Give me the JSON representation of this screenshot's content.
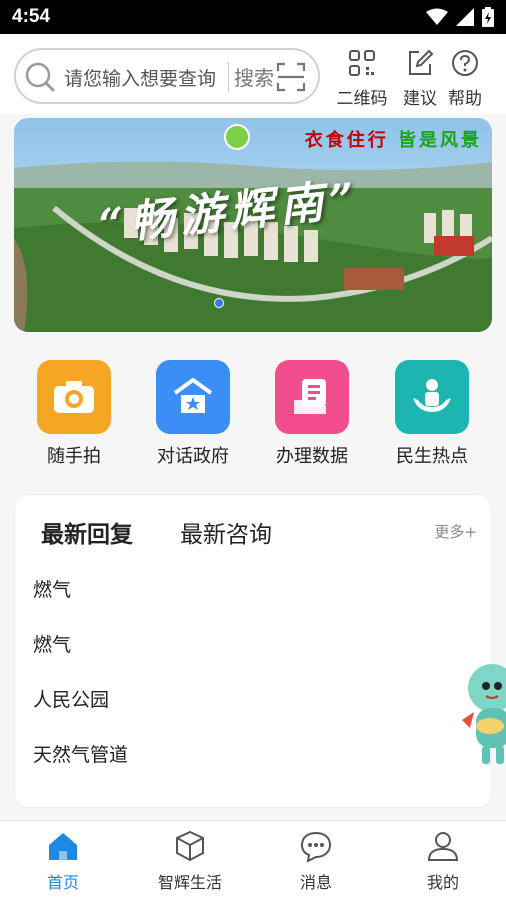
{
  "status_bar": {
    "time": "4:54"
  },
  "search": {
    "placeholder": "请您输入想要查询",
    "button_label": "搜索"
  },
  "tools": [
    {
      "label": "二维码",
      "icon": "qr-code-icon"
    },
    {
      "label": "建议",
      "icon": "edit-icon"
    },
    {
      "label": "帮助",
      "icon": "help-icon"
    }
  ],
  "banner": {
    "slogan_red": "衣食住行",
    "slogan_green": "皆是风景",
    "title": "“畅游辉南”"
  },
  "quick_actions": [
    {
      "label": "随手拍",
      "icon": "camera-icon",
      "color": "#f5a623"
    },
    {
      "label": "对话政府",
      "icon": "government-icon",
      "color": "#3a8ef6"
    },
    {
      "label": "办理数据",
      "icon": "data-icon",
      "color": "#f04e8c"
    },
    {
      "label": "民生热点",
      "icon": "people-icon",
      "color": "#1cb5b0"
    }
  ],
  "news": {
    "tabs": [
      "最新回复",
      "最新咨询"
    ],
    "more_label": "更多+",
    "items": [
      "燃气",
      "燃气",
      "人民公园",
      "天然气管道"
    ]
  },
  "tabbar": [
    {
      "label": "首页",
      "icon": "home-icon",
      "active": true
    },
    {
      "label": "智辉生活",
      "icon": "box-icon",
      "active": false
    },
    {
      "label": "消息",
      "icon": "chat-icon",
      "active": false
    },
    {
      "label": "我的",
      "icon": "user-icon",
      "active": false
    }
  ],
  "colors": {
    "accent": "#1e88e5",
    "tab_highlight": "#6fd5e6"
  }
}
